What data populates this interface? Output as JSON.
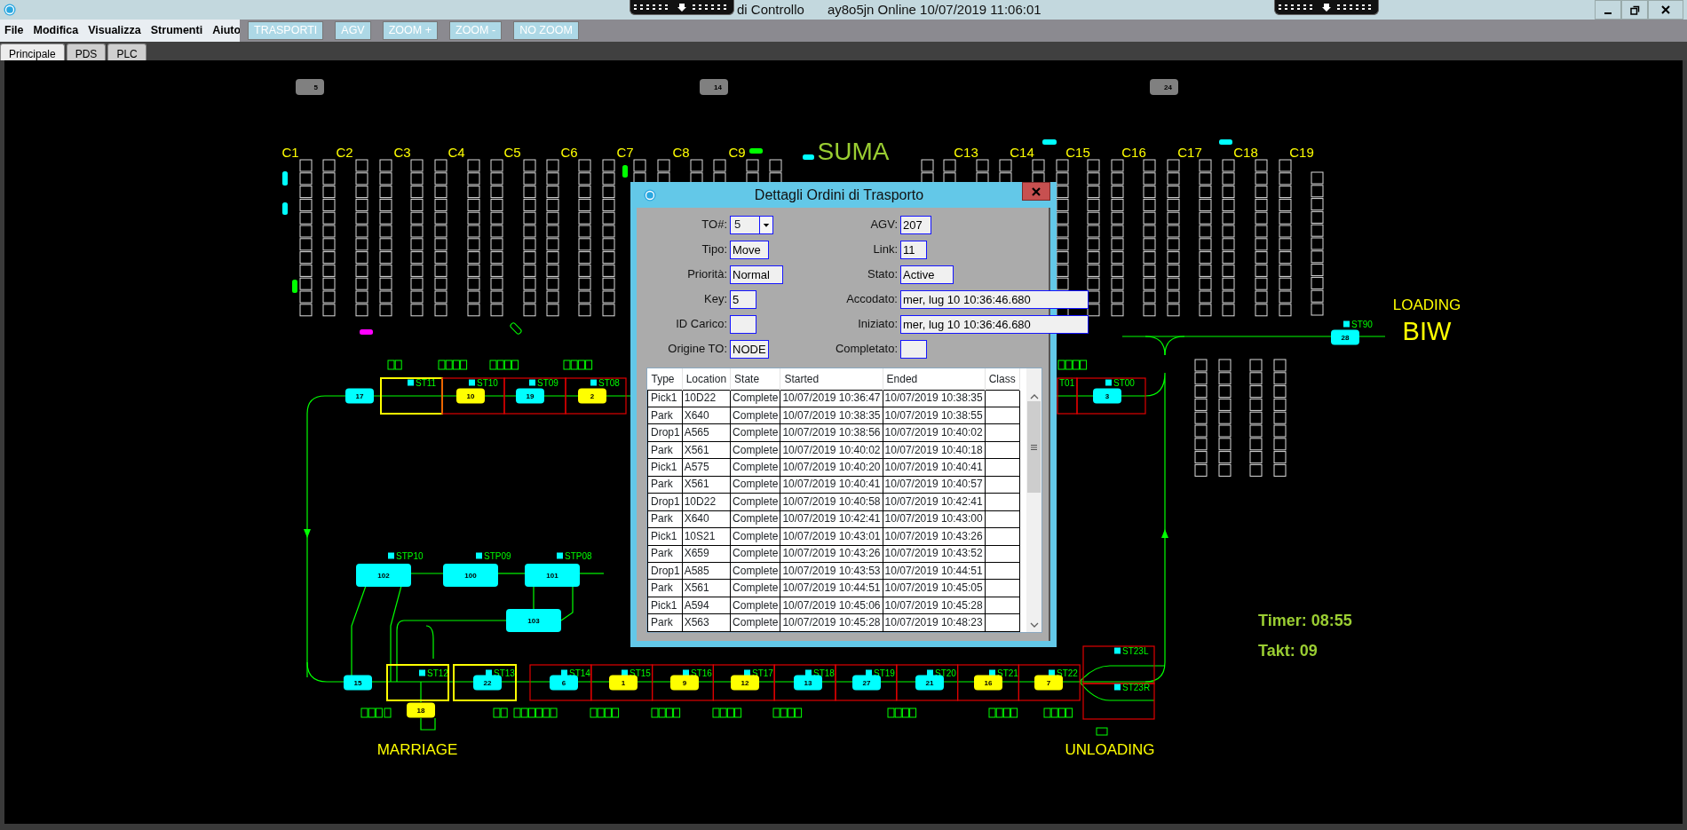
{
  "window": {
    "title": "di Controllo",
    "status": "ay8o5jn Online 10/07/2019 11:06:01"
  },
  "menu": [
    "File",
    "Modifica",
    "Visualizza",
    "Strumenti",
    "Aiuto"
  ],
  "toolbar": [
    "TRASPORTI",
    "AGV",
    "ZOOM +",
    "ZOOM -",
    "NO ZOOM"
  ],
  "tabs": [
    {
      "label": "Principale",
      "selected": true
    },
    {
      "label": "PDS",
      "selected": false
    },
    {
      "label": "PLC",
      "selected": false
    }
  ],
  "map": {
    "badges": [
      "5",
      "14",
      "24"
    ],
    "columns": [
      "C1",
      "C2",
      "C3",
      "C4",
      "C5",
      "C6",
      "C7",
      "C8",
      "C9",
      "C13",
      "C14",
      "C15",
      "C16",
      "C17",
      "C18",
      "C19"
    ],
    "areas": [
      {
        "label": "SUMA",
        "color": "#9acd32"
      },
      {
        "label": "LOADING",
        "color": "#ffff00"
      },
      {
        "label": "BIW",
        "color": "#ffff00"
      },
      {
        "label": "MARRIAGE",
        "color": "#ffff00"
      },
      {
        "label": "UNLOADING",
        "color": "#ffff00"
      }
    ],
    "stations": [
      "ST11",
      "ST10",
      "ST09",
      "ST08",
      "T01",
      "ST00",
      "ST90",
      "STP10",
      "STP09",
      "STP08",
      "ST12",
      "ST13",
      "ST14",
      "ST15",
      "ST16",
      "ST17",
      "ST18",
      "ST19",
      "ST20",
      "ST21",
      "ST22",
      "ST23L",
      "ST23R"
    ],
    "agvs": [
      {
        "label": "17",
        "color": "#00ffff"
      },
      {
        "label": "10",
        "color": "#ffff00"
      },
      {
        "label": "19",
        "color": "#00ffff"
      },
      {
        "label": "2",
        "color": "#ffff00"
      },
      {
        "label": "3",
        "color": "#00ffff"
      },
      {
        "label": "28",
        "color": "#00ffff"
      },
      {
        "label": "102",
        "color": "#00ffff"
      },
      {
        "label": "100",
        "color": "#00ffff"
      },
      {
        "label": "101",
        "color": "#00ffff"
      },
      {
        "label": "103",
        "color": "#00ffff"
      },
      {
        "label": "15",
        "color": "#00ffff"
      },
      {
        "label": "18",
        "color": "#ffff00"
      },
      {
        "label": "22",
        "color": "#00ffff"
      },
      {
        "label": "6",
        "color": "#00ffff"
      },
      {
        "label": "1",
        "color": "#ffff00"
      },
      {
        "label": "9",
        "color": "#ffff00"
      },
      {
        "label": "12",
        "color": "#ffff00"
      },
      {
        "label": "13",
        "color": "#00ffff"
      },
      {
        "label": "27",
        "color": "#00ffff"
      },
      {
        "label": "21",
        "color": "#00ffff"
      },
      {
        "label": "16",
        "color": "#ffff00"
      },
      {
        "label": "7",
        "color": "#ffff00"
      }
    ],
    "timer": "Timer: 08:55",
    "takt": "Takt: 09"
  },
  "dialog": {
    "title": "Dettagli Ordini di Trasporto",
    "left_fields": [
      {
        "label": "TO#:",
        "value": "5",
        "kind": "combo"
      },
      {
        "label": "Tipo:",
        "value": "Move",
        "kind": "text"
      },
      {
        "label": "Priorità:",
        "value": "Normal",
        "kind": "text"
      },
      {
        "label": "Key:",
        "value": "5",
        "kind": "text"
      },
      {
        "label": "ID Carico:",
        "kind": "text"
      },
      {
        "label": "Origine TO:",
        "value": "NODE",
        "kind": "text"
      }
    ],
    "right_fields": [
      {
        "label": "AGV:",
        "value": "207",
        "kind": "text"
      },
      {
        "label": "Link:",
        "value": "11",
        "kind": "text"
      },
      {
        "label": "Stato:",
        "value": "Active",
        "kind": "text"
      },
      {
        "label": "Accodato:",
        "value": "mer, lug 10 10:36:46.680",
        "kind": "text"
      },
      {
        "label": "Iniziato:",
        "value": "mer, lug 10 10:36:46.680",
        "kind": "text"
      },
      {
        "label": "Completato:",
        "kind": "text"
      }
    ],
    "table": {
      "columns": [
        "Type",
        "Location",
        "State",
        "Started",
        "Ended",
        "Class"
      ],
      "rows": [
        [
          "Pick1",
          "10D22",
          "Complete",
          "10/07/2019 10:36:47",
          "10/07/2019 10:38:35"
        ],
        [
          "Park",
          "X640",
          "Complete",
          "10/07/2019 10:38:35",
          "10/07/2019 10:38:55"
        ],
        [
          "Drop1",
          "A565",
          "Complete",
          "10/07/2019 10:38:56",
          "10/07/2019 10:40:02"
        ],
        [
          "Park",
          "X561",
          "Complete",
          "10/07/2019 10:40:02",
          "10/07/2019 10:40:18"
        ],
        [
          "Pick1",
          "A575",
          "Complete",
          "10/07/2019 10:40:20",
          "10/07/2019 10:40:41"
        ],
        [
          "Park",
          "X561",
          "Complete",
          "10/07/2019 10:40:41",
          "10/07/2019 10:40:57"
        ],
        [
          "Drop1",
          "10D22",
          "Complete",
          "10/07/2019 10:40:58",
          "10/07/2019 10:42:41"
        ],
        [
          "Park",
          "X640",
          "Complete",
          "10/07/2019 10:42:41",
          "10/07/2019 10:43:00"
        ],
        [
          "Pick1",
          "10S21",
          "Complete",
          "10/07/2019 10:43:01",
          "10/07/2019 10:43:26"
        ],
        [
          "Park",
          "X659",
          "Complete",
          "10/07/2019 10:43:26",
          "10/07/2019 10:43:52"
        ],
        [
          "Drop1",
          "A585",
          "Complete",
          "10/07/2019 10:43:53",
          "10/07/2019 10:44:51"
        ],
        [
          "Park",
          "X561",
          "Complete",
          "10/07/2019 10:44:51",
          "10/07/2019 10:45:05"
        ],
        [
          "Pick1",
          "A594",
          "Complete",
          "10/07/2019 10:45:06",
          "10/07/2019 10:45:28"
        ],
        [
          "Park",
          "X563",
          "Complete",
          "10/07/2019 10:45:28",
          "10/07/2019 10:48:23"
        ]
      ]
    }
  }
}
